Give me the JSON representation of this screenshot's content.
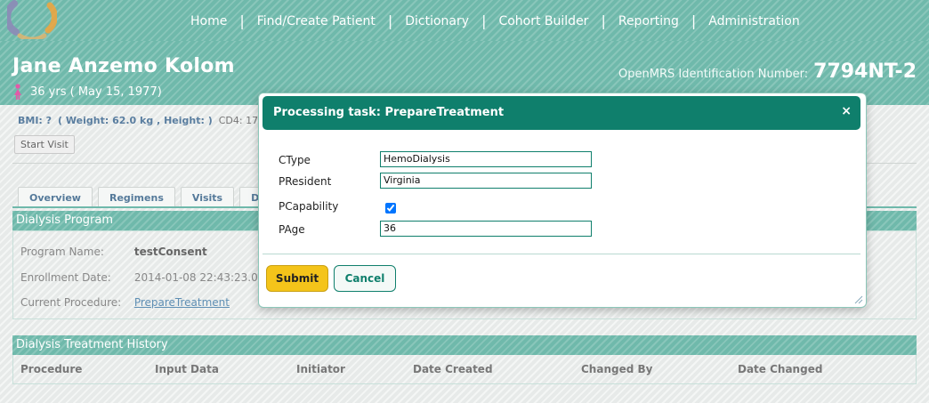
{
  "nav": {
    "items": [
      "Home",
      "Find/Create Patient",
      "Dictionary",
      "Cohort Builder",
      "Reporting",
      "Administration"
    ],
    "separator": "|"
  },
  "patient": {
    "name": "Jane Anzemo Kolom",
    "age_dob": "36 yrs ( May 15, 1977)",
    "id_label": "OpenMRS Identification Number:",
    "id_value": "7794NT-2",
    "bmi_label": "BMI: ?",
    "bmi_detail": "( Weight: 62.0 kg , Height: )",
    "cd4_label": "CD4: 17"
  },
  "actions": {
    "start_visit": "Start Visit"
  },
  "tabs": [
    "Overview",
    "Regimens",
    "Visits",
    "De"
  ],
  "program": {
    "heading": "Dialysis Program",
    "name_label": "Program Name:",
    "name_value": "testConsent",
    "enrollment_label": "Enrollment Date:",
    "enrollment_value": "2014-01-08 22:43:23.0",
    "procedure_label": "Current Procedure:",
    "procedure_value": "PrepareTreatment"
  },
  "history": {
    "heading": "Dialysis Treatment History",
    "columns": [
      "Procedure",
      "Input Data",
      "Initiator",
      "Date Created",
      "Changed By",
      "Date Changed"
    ]
  },
  "modal": {
    "title": "Processing task: PrepareTreatment",
    "close": "×",
    "fields": {
      "ctype": {
        "label": "CType",
        "value": "HemoDialysis"
      },
      "president": {
        "label": "PResident",
        "value": "Virginia"
      },
      "pcapability": {
        "label": "PCapability",
        "checked": true
      },
      "page": {
        "label": "PAge",
        "value": "36"
      }
    },
    "submit": "Submit",
    "cancel": "Cancel"
  },
  "colors": {
    "header_teal": "#6fb9ab",
    "modal_title": "#0f7f6c",
    "submit_yellow": "#f4c41a"
  }
}
